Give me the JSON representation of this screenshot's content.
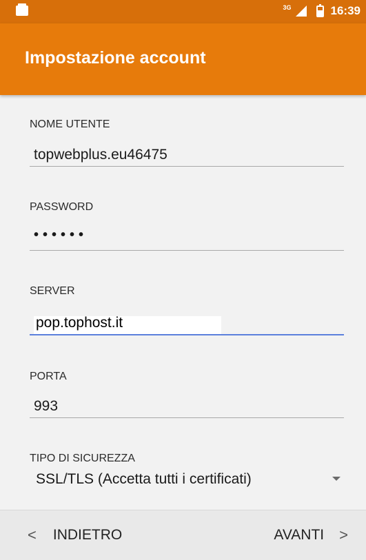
{
  "statusbar": {
    "network": "3G",
    "time": "16:39"
  },
  "appbar": {
    "title": "Impostazione account"
  },
  "fields": {
    "username": {
      "label": "NOME UTENTE",
      "value": "topwebplus.eu46475"
    },
    "password": {
      "label": "PASSWORD",
      "value": "••••••"
    },
    "server": {
      "label": "SERVER",
      "value": "pop.tophost.it"
    },
    "port": {
      "label": "PORTA",
      "value": "993"
    },
    "security": {
      "label": "TIPO DI SICUREZZA",
      "value": "SSL/TLS (Accetta tutti i certificati)"
    }
  },
  "footer": {
    "back_label": "INDIETRO",
    "next_label": "AVANTI",
    "back_chevron": "<",
    "next_chevron": ">"
  },
  "icons": {
    "statusbar_left": "sd-card-icon",
    "signal": "signal-icon",
    "battery": "battery-icon",
    "dropdown": "dropdown-arrow-icon",
    "back": "chevron-left-icon",
    "next": "chevron-right-icon"
  },
  "colors": {
    "appbar": "#e77b0b",
    "statusbar": "#d76f0a",
    "focus_underline": "#5b7fdc"
  }
}
